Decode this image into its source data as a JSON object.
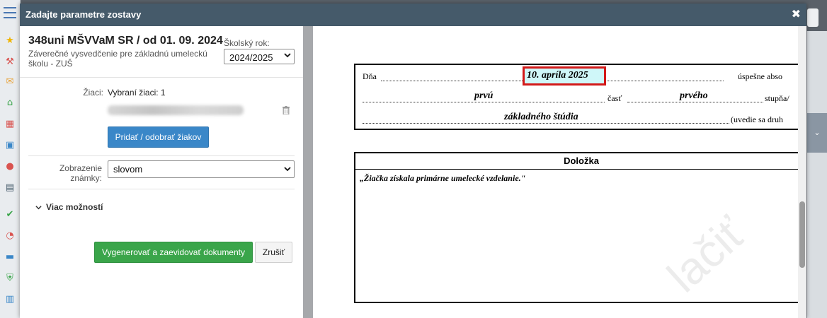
{
  "modal": {
    "title": "Zadajte parametre zostavy",
    "close_glyph": "✖"
  },
  "report": {
    "title": "348uni MŠVVaM SR / od 01. 09. 2024",
    "subtitle": "Záverečné vysvedčenie pre základnú umeleckú školu - ZUŠ",
    "school_year_label": "Školský rok:",
    "school_year_value": "2024/2025"
  },
  "students": {
    "label": "Žiaci:",
    "selected_text": "Vybraní žiaci: 1",
    "add_remove_label": "Pridať / odobrať žiakov"
  },
  "grade_display": {
    "label": "Zobrazenie známky:",
    "value": "slovom"
  },
  "more_options_label": "Viac možností",
  "actions": {
    "generate_label": "Vygenerovať a zaevidovať dokumenty",
    "cancel_label": "Zrušiť"
  },
  "document": {
    "day_label": "Dňa",
    "date_value": "10. apríla 2025",
    "success_text": "úspešne abso",
    "part_value": "prvú",
    "part_label": "časť",
    "level_value": "prvého",
    "level_label": "stupňa/",
    "study_value": "základného štúdia",
    "type_hint": "(uvedie sa druh",
    "clause_heading": "Doložka",
    "clause_text": "„Žiačka získala primárne umelecké vzdelanie.\"",
    "watermark": "lačiť"
  },
  "colors": {
    "header": "#455a6a",
    "primary": "#3a87c8",
    "success": "#3aa54a",
    "highlight_border": "#d21919",
    "highlight_fill": "#cff7f9"
  }
}
